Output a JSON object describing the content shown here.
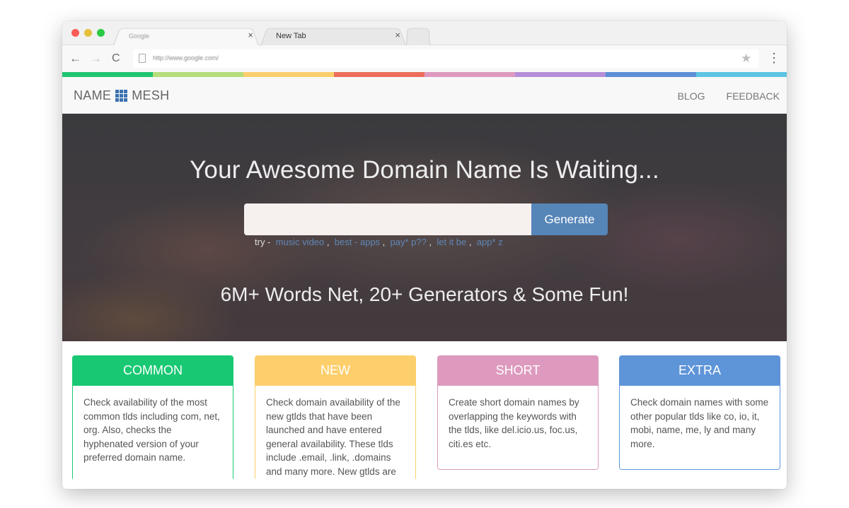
{
  "browser": {
    "tabs": [
      {
        "title": "Google",
        "close": "×"
      },
      {
        "title": "New Tab",
        "close": "×"
      }
    ],
    "nav": {
      "back": "←",
      "forward": "→",
      "reload": "C"
    },
    "url": "http://www.google.com/",
    "star": "★",
    "menu": "⋮"
  },
  "rainbow_colors": [
    "#1fc56f",
    "#b5dd7a",
    "#fdcf6c",
    "#ec6d5c",
    "#dd9abe",
    "#b48fd8",
    "#5e8fd6",
    "#5cc5e3"
  ],
  "site": {
    "brand_left": "NAME",
    "brand_right": "MESH",
    "nav_links": [
      "BLOG",
      "FEEDBACK"
    ]
  },
  "hero": {
    "title": "Your Awesome Domain Name Is Waiting...",
    "search_placeholder": "",
    "generate_label": "Generate",
    "try_prefix": "try -",
    "examples": [
      "music video",
      "best - apps",
      "pay* p??",
      "let it be",
      "app* z"
    ],
    "separator": ",",
    "subtitle": "6M+ Words Net, 20+ Generators & Some Fun!"
  },
  "cards": [
    {
      "title": "COMMON",
      "text": "Check availability of the most common tlds including com, net, org. Also, checks the hyphenated version of your preferred domain name.",
      "color": "#19c873"
    },
    {
      "title": "NEW",
      "text": "Check domain availability of the new gtlds that have been launched and have entered general availability. These tlds include .email, .link, .domains and many more. New gtlds are",
      "color": "#fdcf6c"
    },
    {
      "title": "SHORT",
      "text": "Create short domain names by overlapping the keywords with the tlds, like del.icio.us, foc.us, citi.es etc.",
      "color": "#dd9abe"
    },
    {
      "title": "EXTRA",
      "text": "Check domain names with some other popular tlds like co, io, it, mobi, name, me, ly and many more.",
      "color": "#5e94d8"
    }
  ]
}
